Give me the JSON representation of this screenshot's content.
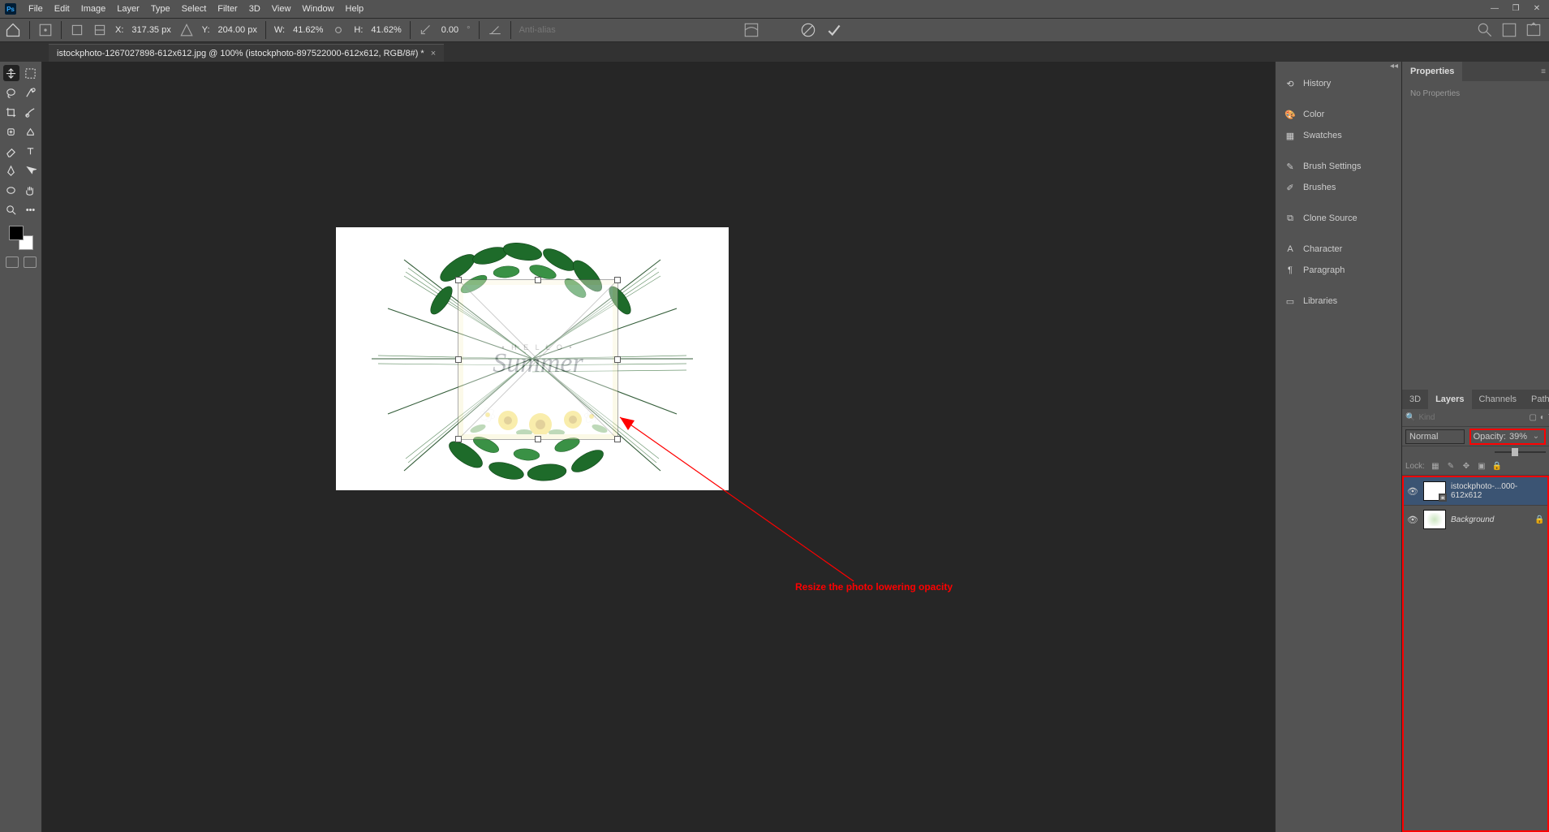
{
  "menu": [
    "File",
    "Edit",
    "Image",
    "Layer",
    "Type",
    "Select",
    "Filter",
    "3D",
    "View",
    "Window",
    "Help"
  ],
  "options": {
    "x_label": "X:",
    "x_val": "317.35 px",
    "y_label": "Y:",
    "y_val": "204.00 px",
    "w_label": "W:",
    "w_val": "41.62%",
    "h_label": "H:",
    "h_val": "41.62%",
    "rot_val": "0.00",
    "interp_label": "Anti-alias"
  },
  "tab": {
    "title": "istockphoto-1267027898-612x612.jpg @ 100% (istockphoto-897522000-612x612, RGB/8#) *"
  },
  "side_panels": [
    {
      "icon": "history-icon",
      "label": "History"
    },
    {
      "icon": "color-icon",
      "label": "Color"
    },
    {
      "icon": "swatches-icon",
      "label": "Swatches"
    },
    {
      "icon": "brush-settings-icon",
      "label": "Brush Settings"
    },
    {
      "icon": "brushes-icon",
      "label": "Brushes"
    },
    {
      "icon": "clone-source-icon",
      "label": "Clone Source"
    },
    {
      "icon": "character-icon",
      "label": "Character"
    },
    {
      "icon": "paragraph-icon",
      "label": "Paragraph"
    },
    {
      "icon": "libraries-icon",
      "label": "Libraries"
    }
  ],
  "properties": {
    "tab": "Properties",
    "body": "No Properties"
  },
  "layer_tabs": [
    "3D",
    "Layers",
    "Channels",
    "Paths"
  ],
  "layers": {
    "kind_placeholder": "Kind",
    "blend_mode": "Normal",
    "opacity_label": "Opacity:",
    "opacity_value": "39%",
    "lock_label": "Lock:",
    "items": [
      {
        "name": "istockphoto-...000-612x612",
        "active": true,
        "italic": false,
        "locked": false
      },
      {
        "name": "Background",
        "active": false,
        "italic": true,
        "locked": true
      }
    ]
  },
  "canvas": {
    "hello": "• H E L L O •",
    "summer": "Summer"
  },
  "annotation": "Resize the photo lowering opacity"
}
